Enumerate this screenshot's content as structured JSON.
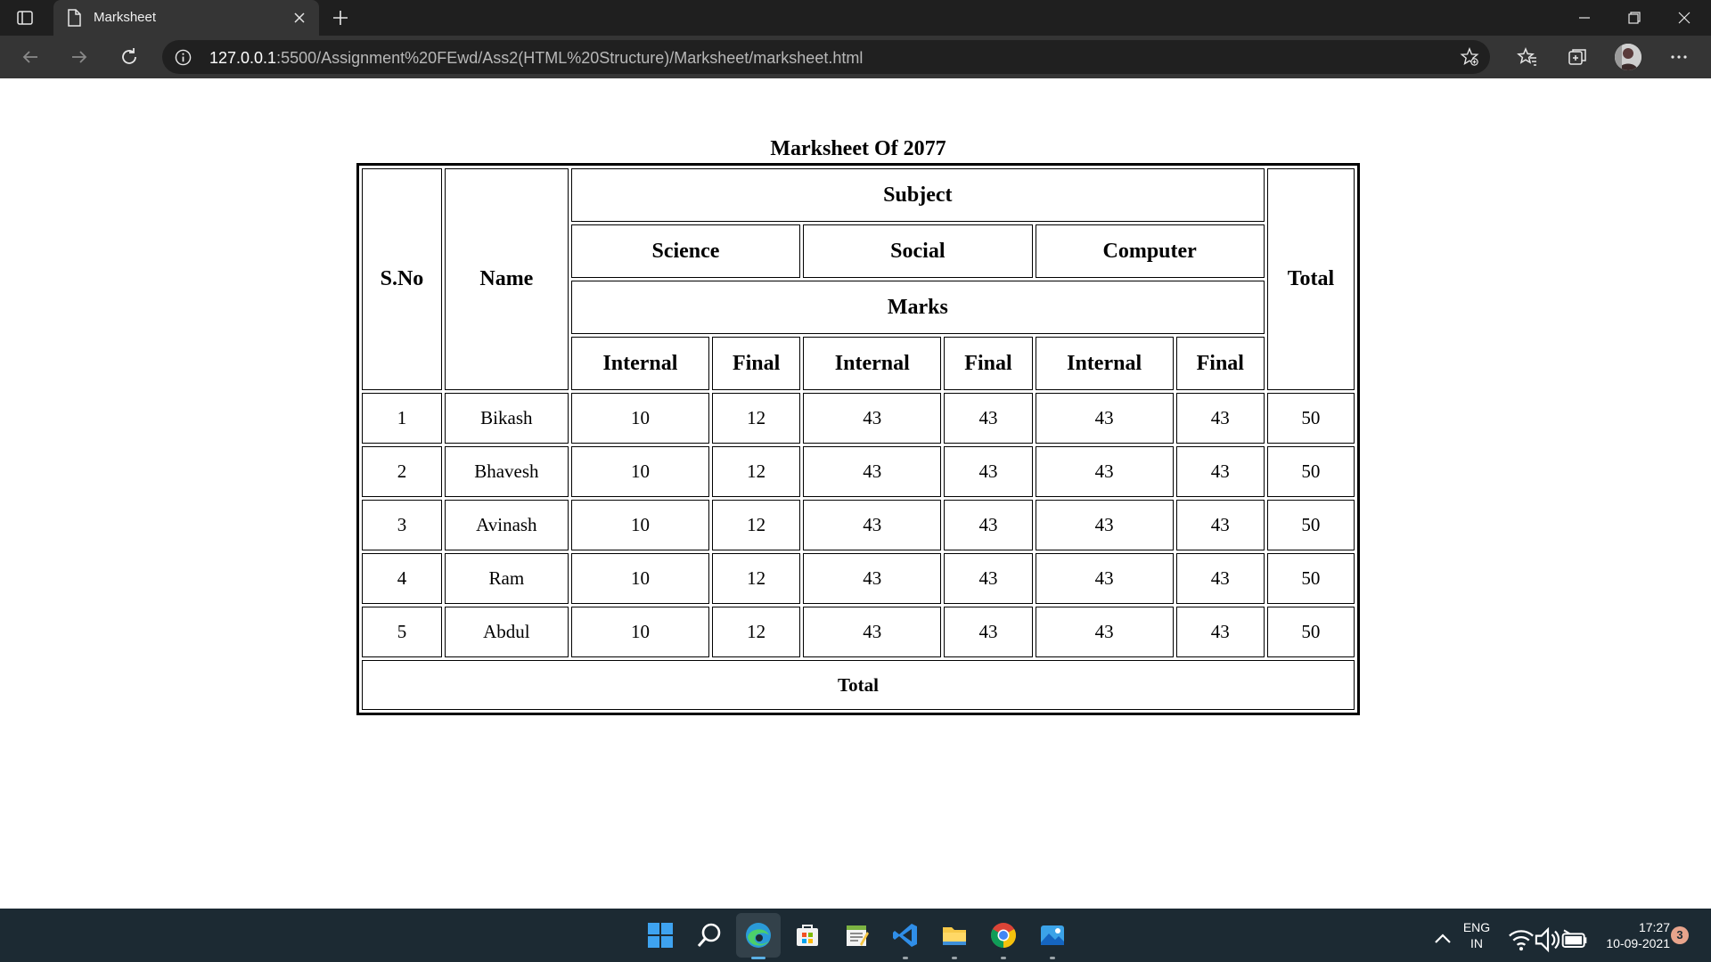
{
  "browser": {
    "tab_title": "Marksheet",
    "url_host": "127.0.0.1",
    "url_rest": ":5500/Assignment%20FEwd/Ass2(HTML%20Structure)/Marksheet/marksheet.html",
    "theme_color": "#1f1f1f"
  },
  "marksheet": {
    "caption": "Marksheet Of 2077",
    "headers": {
      "sno": "S.No",
      "name": "Name",
      "subject": "Subject",
      "total": "Total",
      "marks": "Marks",
      "subjects": [
        "Science",
        "Social",
        "Computer"
      ],
      "internal": "Internal",
      "final": "Final"
    },
    "rows": [
      {
        "sno": "1",
        "name": "Bikash",
        "sci_internal": "10",
        "sci_final": "12",
        "soc_internal": "43",
        "soc_final": "43",
        "comp_internal": "43",
        "comp_final": "43",
        "total": "50"
      },
      {
        "sno": "2",
        "name": "Bhavesh",
        "sci_internal": "10",
        "sci_final": "12",
        "soc_internal": "43",
        "soc_final": "43",
        "comp_internal": "43",
        "comp_final": "43",
        "total": "50"
      },
      {
        "sno": "3",
        "name": "Avinash",
        "sci_internal": "10",
        "sci_final": "12",
        "soc_internal": "43",
        "soc_final": "43",
        "comp_internal": "43",
        "comp_final": "43",
        "total": "50"
      },
      {
        "sno": "4",
        "name": "Ram",
        "sci_internal": "10",
        "sci_final": "12",
        "soc_internal": "43",
        "soc_final": "43",
        "comp_internal": "43",
        "comp_final": "43",
        "total": "50"
      },
      {
        "sno": "5",
        "name": "Abdul",
        "sci_internal": "10",
        "sci_final": "12",
        "soc_internal": "43",
        "soc_final": "43",
        "comp_internal": "43",
        "comp_final": "43",
        "total": "50"
      }
    ],
    "footer_total": "Total"
  },
  "taskbar": {
    "lang_line1": "ENG",
    "lang_line2": "IN",
    "time": "17:27",
    "date": "10-09-2021",
    "notification_count": "3",
    "pinned": [
      "start-icon",
      "search-icon",
      "edge-icon",
      "store-icon",
      "notepad-icon",
      "vscode-icon",
      "file-explorer-icon",
      "chrome-icon",
      "photos-icon"
    ]
  }
}
